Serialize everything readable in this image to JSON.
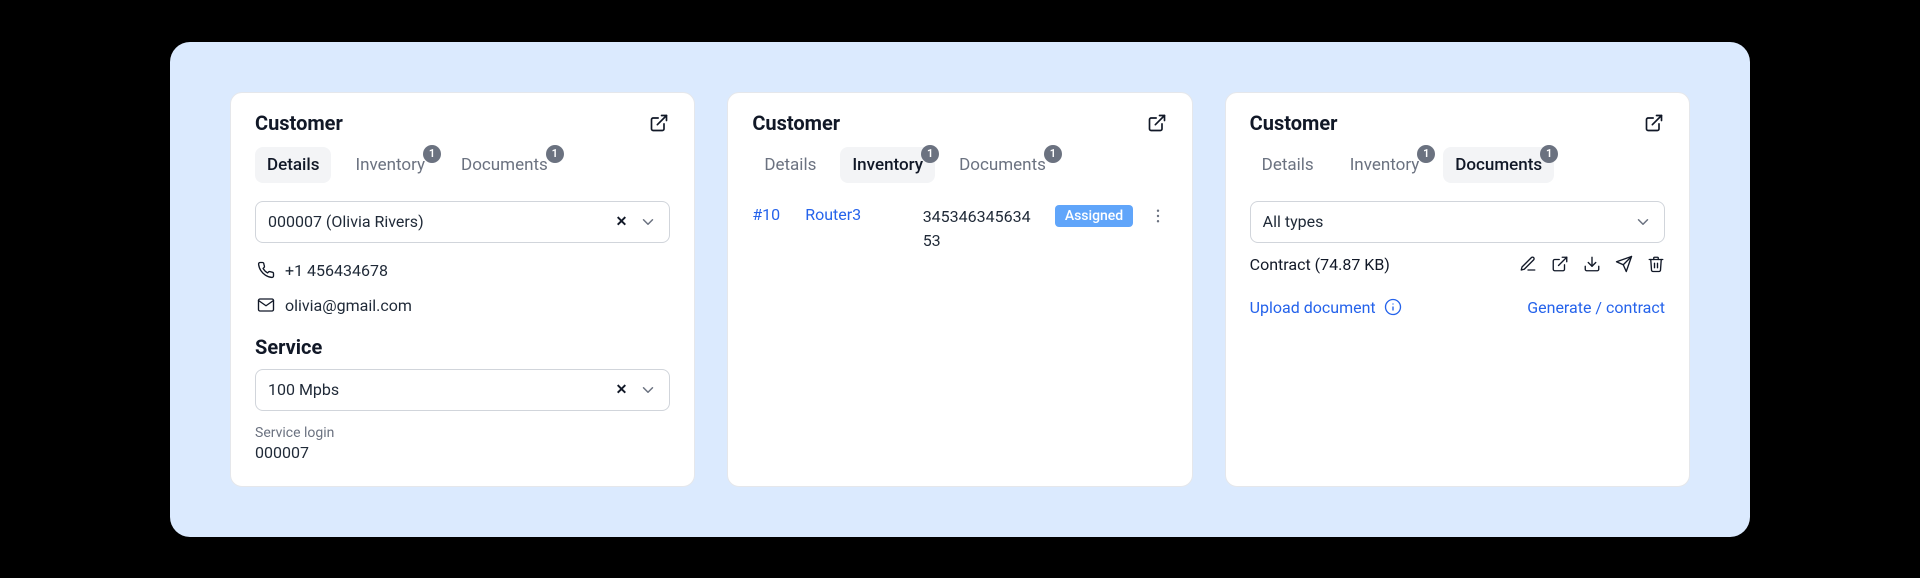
{
  "cards": [
    {
      "title": "Customer",
      "tabs": {
        "details": "Details",
        "inventory": "Inventory",
        "documents": "Documents",
        "inventory_badge": "1",
        "documents_badge": "1"
      },
      "customer_select": "000007 (Olivia Rivers)",
      "phone": "+1 456434678",
      "email": "olivia@gmail.com",
      "service_heading": "Service",
      "service_select": "100 Mpbs",
      "service_login_label": "Service login",
      "service_login_value": "000007"
    },
    {
      "title": "Customer",
      "tabs": {
        "details": "Details",
        "inventory": "Inventory",
        "documents": "Documents",
        "inventory_badge": "1",
        "documents_badge": "1"
      },
      "inventory_row": {
        "id": "#10",
        "name": "Router3",
        "serial": "34534634563453",
        "status": "Assigned"
      }
    },
    {
      "title": "Customer",
      "tabs": {
        "details": "Details",
        "inventory": "Inventory",
        "documents": "Documents",
        "inventory_badge": "1",
        "documents_badge": "1"
      },
      "type_filter": "All types",
      "document_row": "Contract (74.87 KB)",
      "upload_label": "Upload document",
      "generate_label": "Generate / contract"
    }
  ]
}
